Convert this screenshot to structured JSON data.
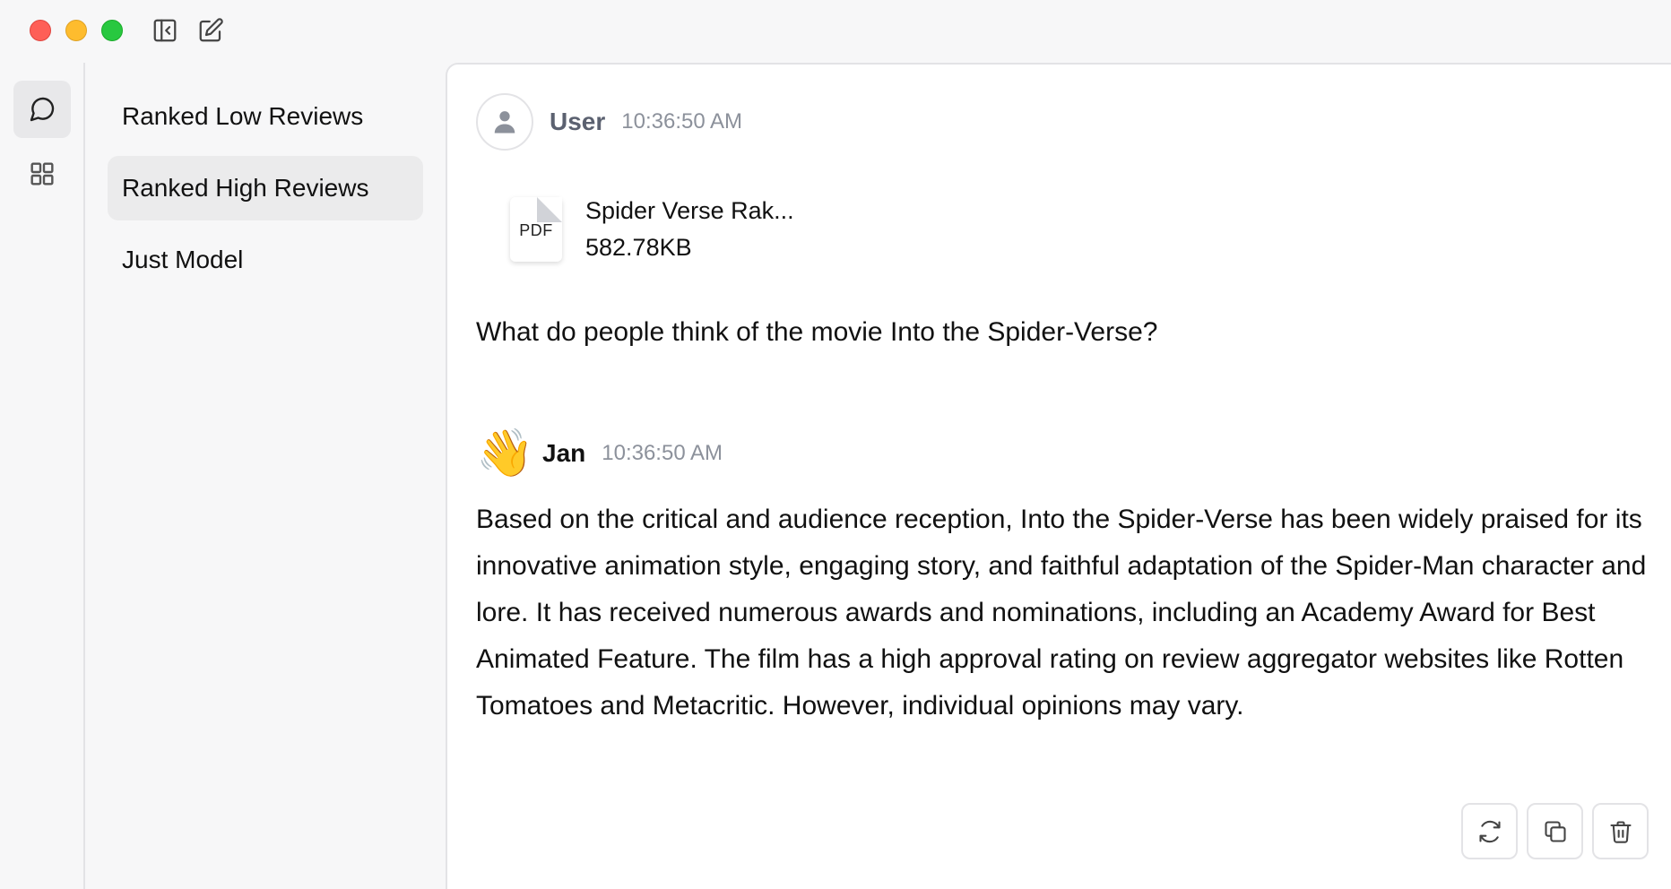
{
  "titlebar": {
    "icons": [
      "sidebar-collapse-icon",
      "compose-icon"
    ]
  },
  "rail": {
    "items": [
      {
        "icon": "chat-icon",
        "active": true
      },
      {
        "icon": "grid-icon",
        "active": false
      }
    ]
  },
  "threads": {
    "items": [
      {
        "label": "Ranked Low Reviews",
        "active": false
      },
      {
        "label": "Ranked High Reviews",
        "active": true
      },
      {
        "label": "Just Model",
        "active": false
      }
    ]
  },
  "messages": {
    "user": {
      "author": "User",
      "time": "10:36:50 AM",
      "attachment": {
        "ext": "PDF",
        "name": "Spider Verse Rak...",
        "size": "582.78KB"
      },
      "text": "What do people think of the movie Into the Spider-Verse?"
    },
    "assistant": {
      "avatar": "👋",
      "author": "Jan",
      "time": "10:36:50 AM",
      "text": "Based on the critical and audience reception, Into the Spider-Verse has been widely praised for its innovative animation style, engaging story, and faithful adaptation of the Spider-Man character and lore. It has received numerous awards and nominations, including an Academy Award for Best Animated Feature. The film has a high approval rating on review aggregator websites like Rotten Tomatoes and Metacritic. However, individual opinions may vary."
    }
  },
  "actions": {
    "icons": [
      "regenerate-icon",
      "copy-icon",
      "delete-icon"
    ]
  },
  "colors": {
    "traffic_red": "#fe5f57",
    "traffic_yellow": "#febc2e",
    "traffic_green": "#28c840",
    "active_bg": "#ebebec",
    "muted_text": "#8c919b"
  }
}
